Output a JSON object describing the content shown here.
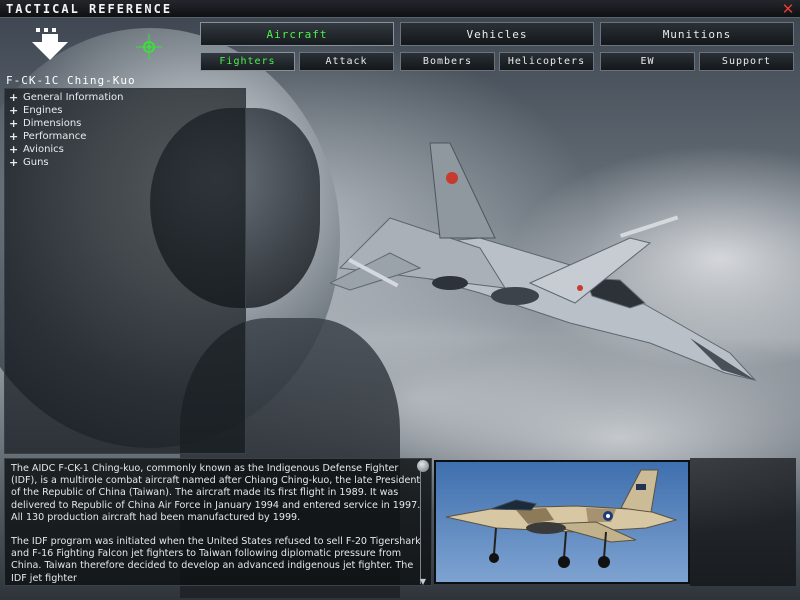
{
  "window": {
    "title": "Tactical Reference",
    "close_glyph": "✕"
  },
  "icons": {
    "back": "down-arrow-icon",
    "crosshair": "crosshair-icon",
    "expand": "plus-icon",
    "close": "close-icon"
  },
  "colors": {
    "accent_green": "#4cf04c",
    "close_red": "#e33b2f",
    "button_border": "#6b737b"
  },
  "categories": [
    {
      "label": "Aircraft",
      "active": true
    },
    {
      "label": "Vehicles",
      "active": false
    },
    {
      "label": "Munitions",
      "active": false
    }
  ],
  "subcategories": [
    {
      "label": "Fighters",
      "active": true
    },
    {
      "label": "Attack",
      "active": false
    },
    {
      "label": "Bombers",
      "active": false
    },
    {
      "label": "Helicopters",
      "active": false
    },
    {
      "label": "EW",
      "active": false
    },
    {
      "label": "Support",
      "active": false
    }
  ],
  "aircraft": {
    "name": "F-CK-1C Ching-Kuo",
    "sections": [
      "General Information",
      "Engines",
      "Dimensions",
      "Performance",
      "Avionics",
      "Guns"
    ]
  },
  "description": {
    "paragraphs": [
      "The AIDC F-CK-1 Ching-kuo, commonly known as the Indigenous Defense Fighter (IDF), is a multirole combat aircraft named after Chiang Ching-kuo, the late President of the Republic of China (Taiwan). The aircraft made its first flight in 1989. It was delivered to Republic of China Air Force in January 1994 and entered service in 1997. All 130 production aircraft had been manufactured by 1999.",
      "The IDF program was initiated when the United States refused to sell F-20 Tigershark and F-16 Fighting Falcon jet fighters to Taiwan following diplomatic pressure from China. Taiwan therefore decided to develop an advanced indigenous jet fighter. The IDF jet fighter"
    ]
  }
}
